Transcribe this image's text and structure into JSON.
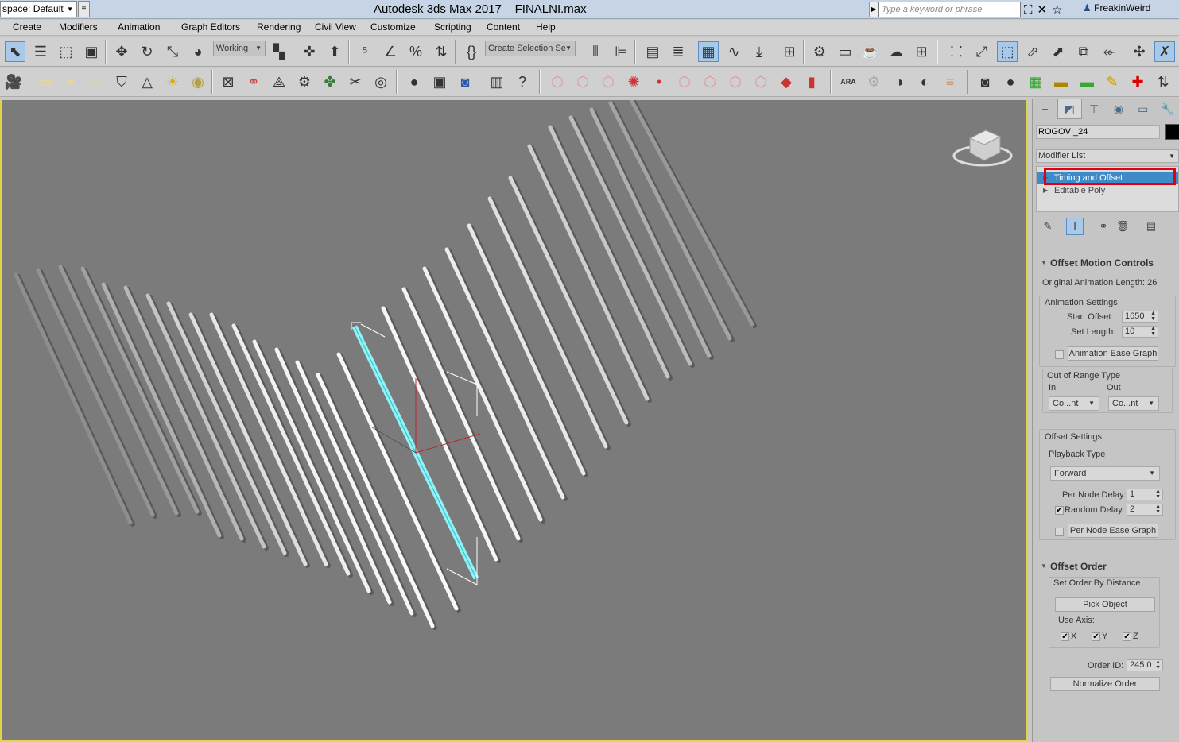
{
  "titlebar": {
    "workspace": "space: Default",
    "app_title": "Autodesk 3ds Max 2017",
    "file_name": "FINALNI.max",
    "search_placeholder": "Type a keyword or phrase",
    "user": "FreakinWeird"
  },
  "menu": [
    "Create",
    "Modifiers",
    "Animation",
    "Graph Editors",
    "Rendering",
    "Civil View",
    "Customize",
    "Scripting",
    "Content",
    "Help"
  ],
  "toolbar": {
    "working_label": "Working",
    "selection_set_label": "Create Selection Se"
  },
  "panel": {
    "object_name": "ROGOVI_24",
    "modifier_list_label": "Modifier List",
    "stack": [
      "Timing and Offset",
      "Editable Poly"
    ],
    "offset_motion": {
      "title": "Offset Motion Controls",
      "original_length": "Original Animation Length: 26",
      "anim_settings_label": "Animation Settings",
      "start_offset_label": "Start Offset:",
      "start_offset_value": "1650",
      "set_length_label": "Set Length:",
      "set_length_value": "10",
      "anim_ease_graph": "Animation Ease Graph",
      "out_of_range_label": "Out of Range Type",
      "in_label": "In",
      "out_label": "Out",
      "in_value": "Co...nt",
      "out_value": "Co...nt",
      "offset_settings_label": "Offset Settings",
      "playback_type_label": "Playback Type",
      "playback_value": "Forward",
      "per_node_delay_label": "Per Node Delay:",
      "per_node_delay_value": "1",
      "random_delay_label": "Random Delay:",
      "random_delay_value": "2",
      "per_node_ease_graph": "Per Node Ease Graph"
    },
    "offset_order": {
      "title": "Offset Order",
      "set_order_label": "Set Order By Distance",
      "pick_object": "Pick Object",
      "use_axis_label": "Use Axis:",
      "axis_x": "X",
      "axis_y": "Y",
      "axis_z": "Z",
      "order_id_label": "Order ID:",
      "order_id_value": "245.0",
      "normalize_order": "Normalize Order"
    }
  },
  "colors": {
    "viewport_bg": "#7b7b7b",
    "viewport_border": "#e2d448",
    "selected_object": "#7fe9f0",
    "highlight_box": "#e00012"
  }
}
